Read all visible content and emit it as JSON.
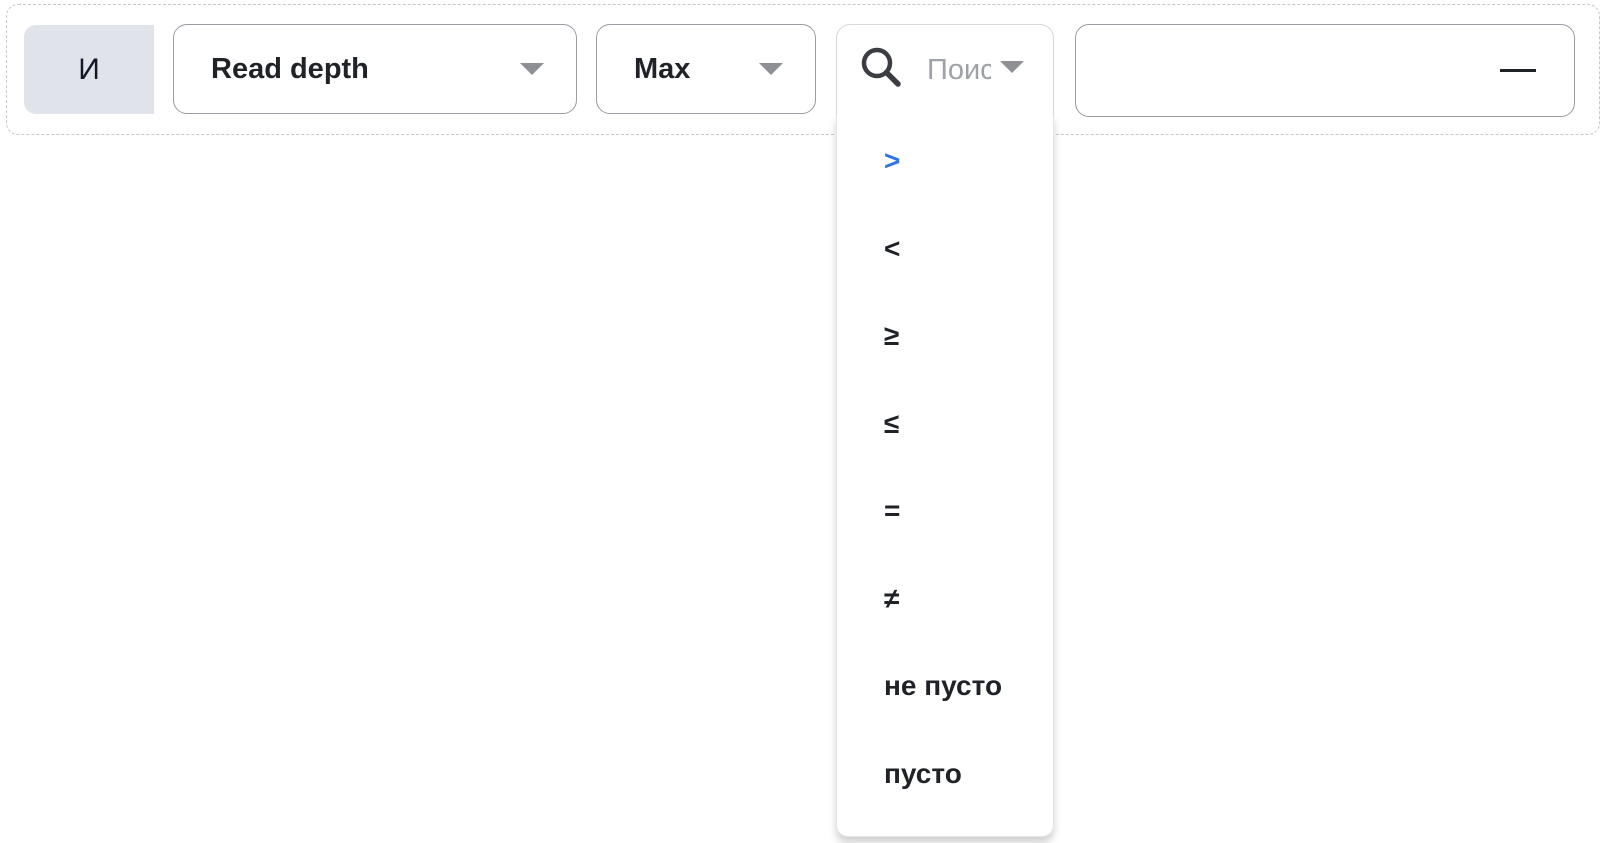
{
  "logic": {
    "label": "И"
  },
  "field_select": {
    "value": "Read depth"
  },
  "aggregate_select": {
    "value": "Max"
  },
  "operator_select": {
    "placeholder": "Поиск"
  },
  "value_input": {
    "value": "—"
  },
  "operator_dropdown": {
    "options": [
      ">",
      "<",
      "≥",
      "≤",
      "=",
      "≠",
      "не пусто",
      "пусто"
    ],
    "highlighted_index": 0
  },
  "colors": {
    "accent": "#2f74e6",
    "badge_bg": "#e0e3e9",
    "text": "#1f2328",
    "placeholder": "#9ea1a8"
  },
  "icons": {
    "search": "search-icon",
    "caret": "chevron-down-icon"
  }
}
